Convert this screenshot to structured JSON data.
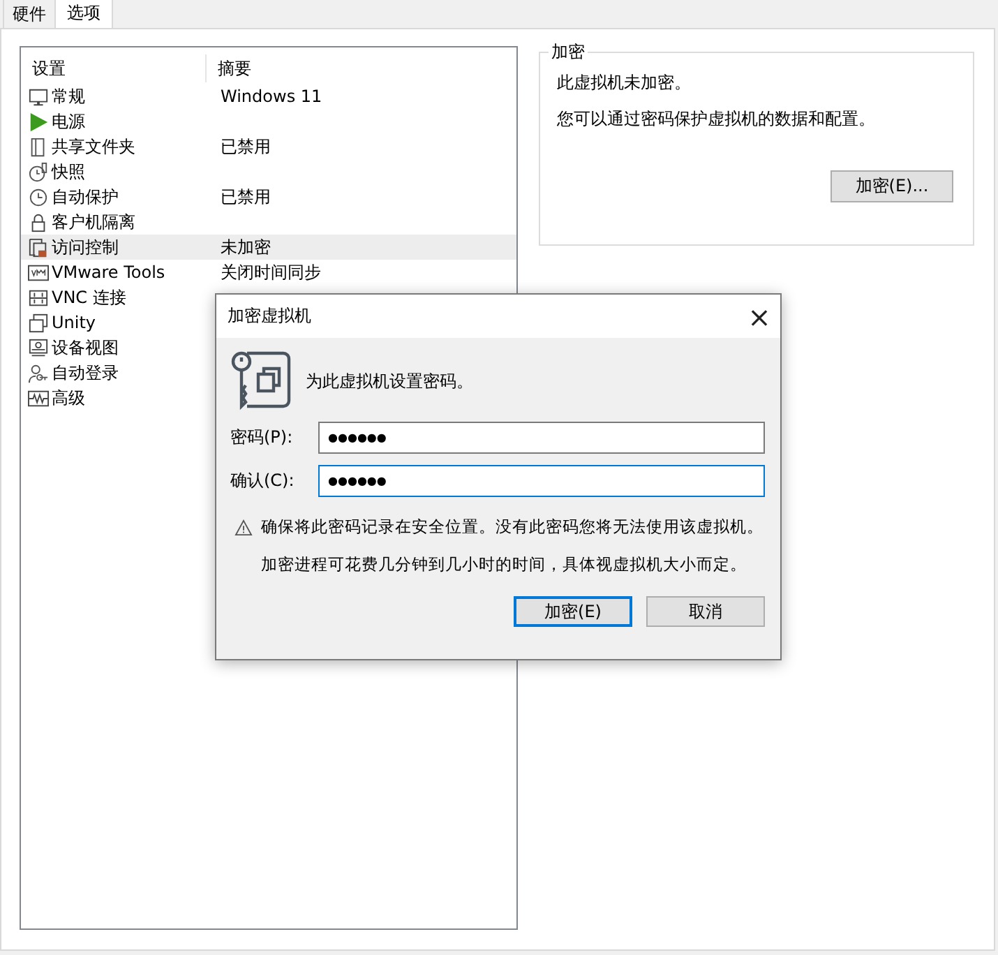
{
  "tabs": [
    {
      "label": "硬件",
      "selected": false
    },
    {
      "label": "选项",
      "selected": true
    }
  ],
  "settings_list": {
    "columns": [
      "设置",
      "摘要"
    ],
    "rows": [
      {
        "name": "常规",
        "summary": "Windows 11",
        "selected": false
      },
      {
        "name": "电源",
        "selected": false
      },
      {
        "name": "共享文件夹",
        "summary": "已禁用",
        "selected": false
      },
      {
        "name": "快照",
        "selected": false
      },
      {
        "name": "自动保护",
        "summary": "已禁用",
        "selected": false
      },
      {
        "name": "客户机隔离",
        "selected": false
      },
      {
        "name": "访问控制",
        "summary": "未加密",
        "selected": true
      },
      {
        "name": "VMware Tools",
        "summary": "关闭时间同步",
        "selected": false
      },
      {
        "name": "VNC 连接",
        "selected": false
      },
      {
        "name": "Unity",
        "selected": false
      },
      {
        "name": "设备视图",
        "selected": false
      },
      {
        "name": "自动登录",
        "selected": false
      },
      {
        "name": "高级",
        "selected": false
      }
    ]
  },
  "encryption_group": {
    "title": "加密",
    "status": "此虚拟机未加密。",
    "description": "您可以通过密码保护虚拟机的数据和配置。",
    "button": "加密(E)..."
  },
  "dialog": {
    "title": "加密虚拟机",
    "close": "×",
    "prompt": "为此虚拟机设置密码。",
    "fields": [
      {
        "label": "密码(P):",
        "value": "●●●●●●",
        "focused": false
      },
      {
        "label": "确认(C):",
        "value": "●●●●●●",
        "focused": true
      }
    ],
    "warning": "确保将此密码记录在安全位置。没有此密码您将无法使用该虚拟机。",
    "note": "加密进程可花费几分钟到几小时的时间，具体视虚拟机大小而定。",
    "buttons": [
      {
        "label": "加密(E)",
        "default": true
      },
      {
        "label": "取消",
        "default": false
      }
    ]
  }
}
